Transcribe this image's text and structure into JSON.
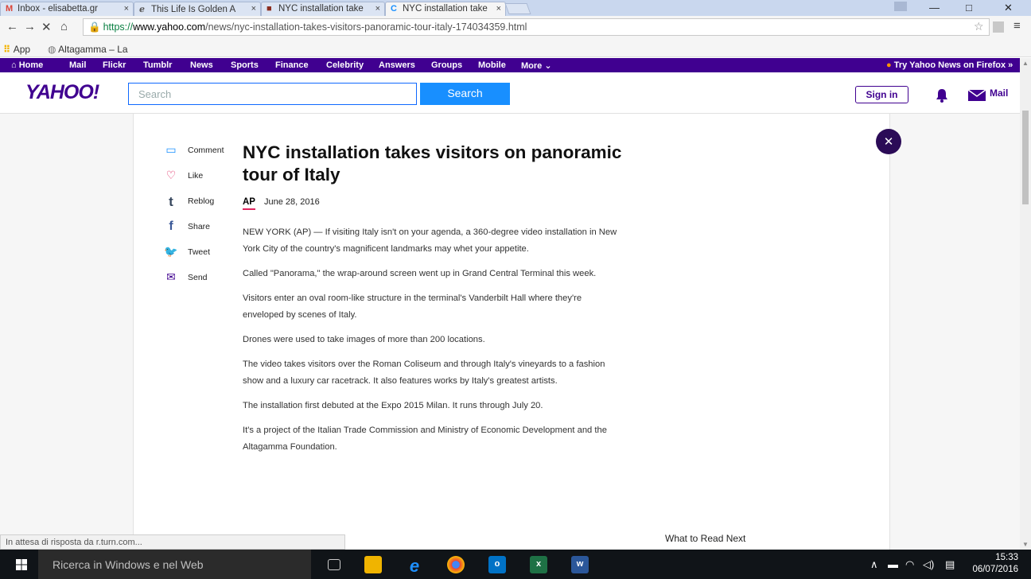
{
  "browser": {
    "tabs": [
      {
        "label": "Inbox - elisabetta.gr",
        "favicon": "M",
        "favicon_color": "#db4437"
      },
      {
        "label": "This Life Is Golden A",
        "favicon": "ℯ",
        "favicon_color": "#555555"
      },
      {
        "label": "NYC installation take",
        "favicon": "■",
        "favicon_color": "#8b2d1f"
      },
      {
        "label": "NYC installation take",
        "favicon": "C",
        "favicon_color": "#188fff"
      }
    ],
    "url": {
      "protocol": "https://",
      "host": "www.yahoo.com",
      "path": "/news/nyc-installation-takes-visitors-panoramic-tour-italy-174034359.html"
    },
    "bookmarks": [
      {
        "label": "App",
        "icon": "apps-grid-icon"
      },
      {
        "label": "Altagamma – La",
        "icon": "globe-icon"
      }
    ]
  },
  "yahoo_nav": {
    "items": [
      "Home",
      "Mail",
      "Flickr",
      "Tumblr",
      "News",
      "Sports",
      "Finance",
      "Celebrity",
      "Answers",
      "Groups",
      "Mobile",
      "More ⌄"
    ],
    "promo": "Try Yahoo News on Firefox »"
  },
  "header": {
    "logo": "YAHOO!",
    "search_placeholder": "Search",
    "search_button": "Search",
    "sign_in": "Sign in",
    "mail": "Mail"
  },
  "share_rail": [
    {
      "label": "Comment",
      "icon": "comment-icon"
    },
    {
      "label": "Like",
      "icon": "heart-icon"
    },
    {
      "label": "Reblog",
      "icon": "tumblr-icon"
    },
    {
      "label": "Share",
      "icon": "facebook-icon"
    },
    {
      "label": "Tweet",
      "icon": "twitter-icon"
    },
    {
      "label": "Send",
      "icon": "envelope-icon"
    }
  ],
  "article": {
    "headline": "NYC installation takes visitors on panoramic tour of Italy",
    "source": "AP",
    "date": "June 28, 2016",
    "paragraphs": [
      "NEW YORK (AP) — If visiting Italy isn't on your agenda, a 360-degree video installation in New York City of the country's magnificent landmarks may whet your appetite.",
      "Called \"Panorama,\" the wrap-around screen went up in Grand Central Terminal this week.",
      "Visitors enter an oval room-like structure in the terminal's Vanderbilt Hall where they're enveloped by scenes of Italy.",
      "Drones were used to take images of more than 200 locations.",
      "The video takes visitors over the Roman Coliseum and through Italy's vineyards to a fashion show and a luxury car racetrack. It also features works by Italy's greatest artists.",
      "The installation first debuted at the Expo 2015 Milan. It runs through July 20.",
      "It's a project of the Italian Trade Commission and Ministry of Economic Development and the Altagamma Foundation."
    ]
  },
  "read_next": "What to Read Next",
  "status_bar": "In attesa di risposta da r.turn.com...",
  "taskbar": {
    "search": "Ricerca in Windows e nel Web",
    "time": "15:33",
    "date": "06/07/2016"
  },
  "colors": {
    "yahoo_purple": "#400090",
    "search_blue": "#188fff"
  }
}
